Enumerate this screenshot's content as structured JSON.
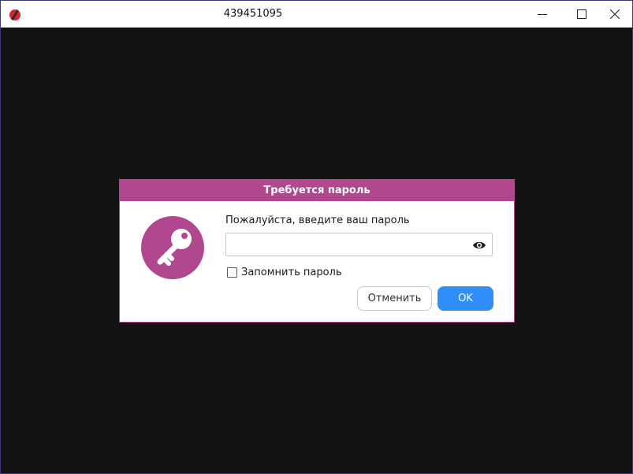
{
  "window": {
    "title": "439451095",
    "app_icon": "app-logo-icon",
    "controls": {
      "minimize_icon": "minimize-icon",
      "maximize_icon": "maximize-icon",
      "close_icon": "close-icon"
    }
  },
  "dialog": {
    "header": "Требуется пароль",
    "icon": "key-icon",
    "prompt": "Пожалуйста, введите ваш пароль",
    "password_field": {
      "value": "",
      "placeholder": "",
      "toggle_icon": "eye-icon"
    },
    "remember": {
      "label": "Запомнить пароль",
      "checked": false
    },
    "buttons": {
      "cancel": "Отменить",
      "ok": "OK"
    }
  },
  "colors": {
    "accent": "#b0478f",
    "primary_button": "#2f8ef8",
    "background": "#121212"
  }
}
